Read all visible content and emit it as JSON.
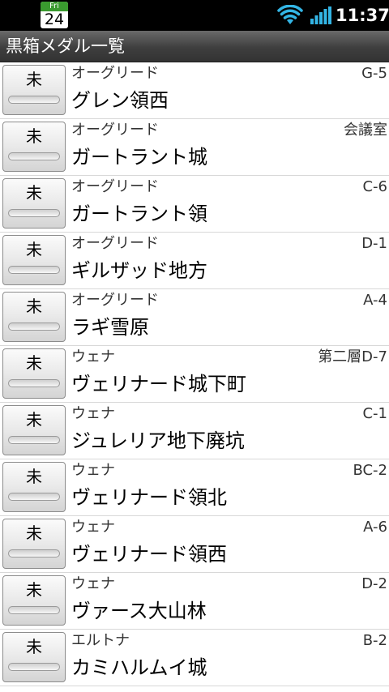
{
  "status_bar": {
    "calendar_day": "Fri",
    "calendar_date": "24",
    "time": "11:37",
    "wifi_icon": "wifi-icon",
    "signal_icon": "signal-icon",
    "accent_color": "#33b5e5"
  },
  "app": {
    "title": "黒箱メダル一覧"
  },
  "medals": [
    {
      "status": "未",
      "region": "オーグリード",
      "code": "G-5",
      "name": "グレン領西"
    },
    {
      "status": "未",
      "region": "オーグリード",
      "code": "会議室",
      "name": "ガートラント城"
    },
    {
      "status": "未",
      "region": "オーグリード",
      "code": "C-6",
      "name": "ガートラント領"
    },
    {
      "status": "未",
      "region": "オーグリード",
      "code": "D-1",
      "name": "ギルザッド地方"
    },
    {
      "status": "未",
      "region": "オーグリード",
      "code": "A-4",
      "name": "ラギ雪原"
    },
    {
      "status": "未",
      "region": "ウェナ",
      "code": "第二層D-7",
      "name": "ヴェリナード城下町"
    },
    {
      "status": "未",
      "region": "ウェナ",
      "code": "C-1",
      "name": "ジュレリア地下廃坑"
    },
    {
      "status": "未",
      "region": "ウェナ",
      "code": "BC-2",
      "name": "ヴェリナード領北"
    },
    {
      "status": "未",
      "region": "ウェナ",
      "code": "A-6",
      "name": "ヴェリナード領西"
    },
    {
      "status": "未",
      "region": "ウェナ",
      "code": "D-2",
      "name": "ヴァース大山林"
    },
    {
      "status": "未",
      "region": "エルトナ",
      "code": "B-2",
      "name": "カミハルムイ城"
    }
  ]
}
